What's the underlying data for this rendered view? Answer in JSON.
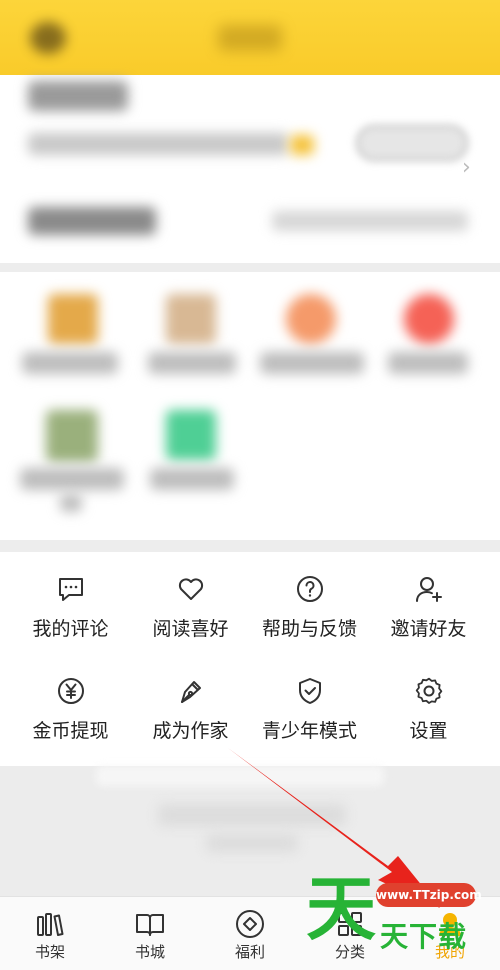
{
  "menu": {
    "items": [
      {
        "label": "我的评论",
        "icon": "comment-icon"
      },
      {
        "label": "阅读喜好",
        "icon": "heart-icon"
      },
      {
        "label": "帮助与反馈",
        "icon": "help-icon"
      },
      {
        "label": "邀请好友",
        "icon": "invite-friend-icon"
      },
      {
        "label": "金币提现",
        "icon": "coin-yen-icon"
      },
      {
        "label": "成为作家",
        "icon": "pen-icon"
      },
      {
        "label": "青少年模式",
        "icon": "shield-icon"
      },
      {
        "label": "设置",
        "icon": "gear-icon"
      }
    ]
  },
  "tabbar": {
    "items": [
      {
        "label": "书架",
        "icon": "bookshelf-icon"
      },
      {
        "label": "书城",
        "icon": "book-open-icon"
      },
      {
        "label": "福利",
        "icon": "welfare-icon"
      },
      {
        "label": "分类",
        "icon": "category-icon"
      },
      {
        "label": "我的",
        "icon": "profile-icon"
      }
    ],
    "active_index": 4,
    "active_color": "#f0a400"
  },
  "watermark": {
    "url": "www.TTzip.com",
    "big_char": "天",
    "text": "天下载"
  },
  "colors": {
    "header": "#f9cb2a",
    "arrow": "#e8231c"
  }
}
